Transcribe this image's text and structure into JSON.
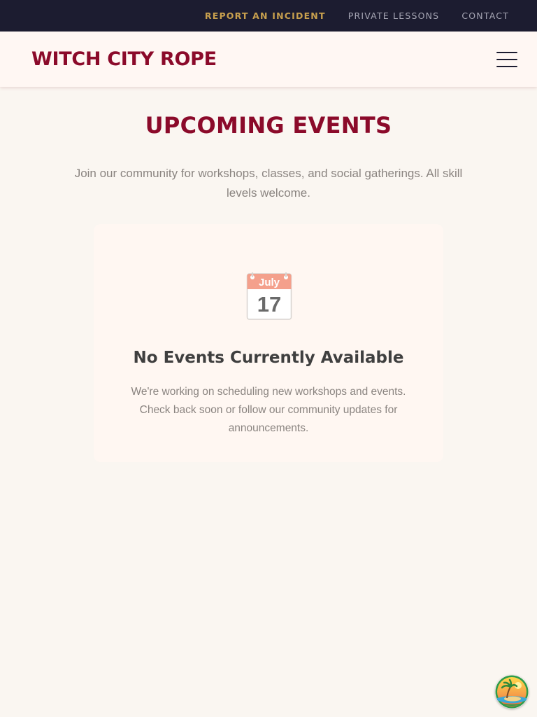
{
  "utility_nav": {
    "links": [
      {
        "label": "REPORT AN INCIDENT"
      },
      {
        "label": "PRIVATE LESSONS"
      },
      {
        "label": "CONTACT"
      }
    ]
  },
  "header": {
    "logo": "WITCH CITY ROPE",
    "menu_icon": "hamburger-menu-icon"
  },
  "hero": {
    "title": "UPCOMING EVENTS",
    "intro": "Join our community for workshops, classes, and social gatherings. All skill levels welcome."
  },
  "empty_state": {
    "icon": "calendar-icon",
    "calendar_month": "July",
    "calendar_day": "17",
    "title": "No Events Currently Available",
    "message": "We're working on scheduling new workshops and events. Check back soon or follow our community updates for announcements."
  },
  "widget": {
    "icon": "palm-tree-island-icon"
  },
  "colors": {
    "utility_bar_bg": "#1c1c30",
    "highlight_link": "#c8a04e",
    "brand": "#8b0a2a",
    "page_bg": "#faf6f1",
    "card_bg": "#fff7f2"
  }
}
